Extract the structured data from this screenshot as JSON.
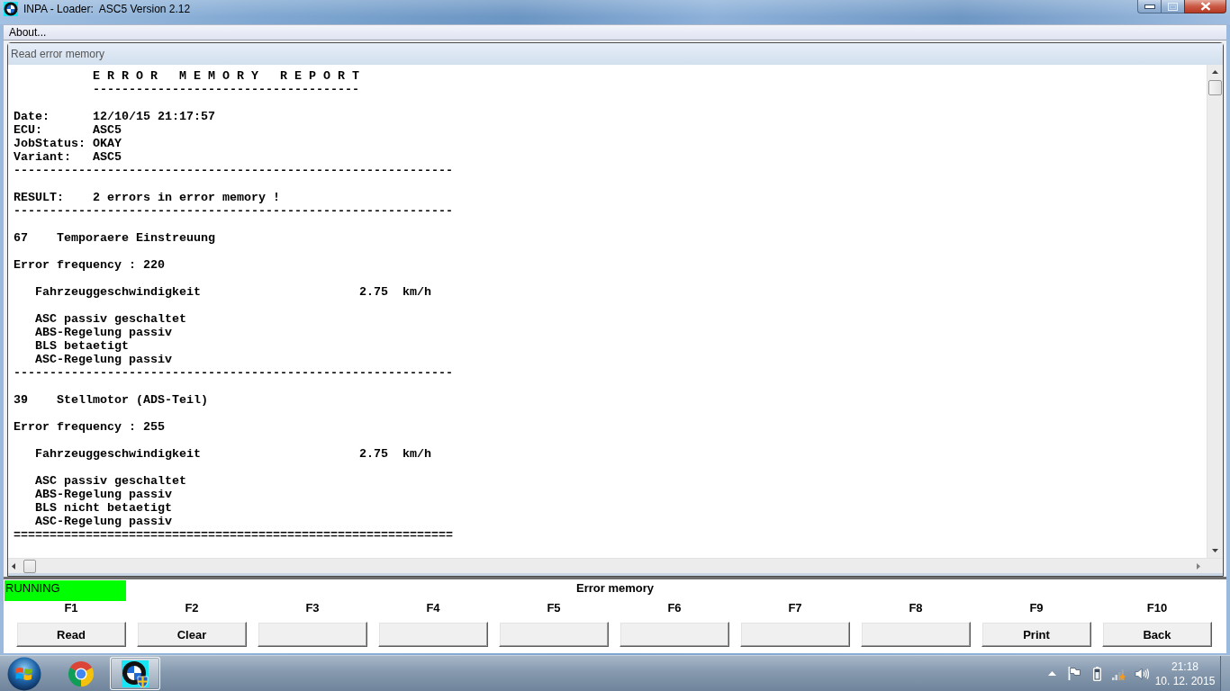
{
  "window": {
    "title": "INPA - Loader:  ASC5 Version 2.12"
  },
  "menu_bar": {
    "items": [
      "About..."
    ]
  },
  "panel": {
    "title": "Read error memory",
    "report": {
      "blocks": [
        {
          "lines": [
            {
              "kind": "title",
              "text": "E R R O R   M E M O R Y   R E P O R T"
            },
            {
              "kind": "title_rule",
              "text": "-------------------------------------"
            }
          ]
        },
        {
          "lines": [
            {
              "kind": "line",
              "text": "Date:      12/10/15 21:17:57"
            },
            {
              "kind": "line",
              "text": "ECU:       ASC5"
            },
            {
              "kind": "line",
              "text": "JobStatus: OKAY"
            },
            {
              "kind": "line",
              "text": "Variant:   ASC5"
            },
            {
              "kind": "rule",
              "text": "-------------------------------------------------------------"
            }
          ]
        },
        {
          "lines": [
            {
              "kind": "line",
              "text": "RESULT:    2 errors in error memory !"
            },
            {
              "kind": "rule",
              "text": "-------------------------------------------------------------"
            }
          ]
        },
        {
          "lines": [
            {
              "kind": "line",
              "text": "67    Temporaere Einstreuung"
            }
          ]
        },
        {
          "lines": [
            {
              "kind": "line",
              "text": "Error frequency : 220"
            }
          ]
        },
        {
          "lines": [
            {
              "kind": "detail",
              "text": "Fahrzeuggeschwindigkeit                      2.75  km/h"
            }
          ]
        },
        {
          "lines": [
            {
              "kind": "detail",
              "text": "ASC passiv geschaltet"
            },
            {
              "kind": "detail",
              "text": "ABS-Regelung passiv"
            },
            {
              "kind": "detail",
              "text": "BLS betaetigt"
            },
            {
              "kind": "detail",
              "text": "ASC-Regelung passiv"
            },
            {
              "kind": "rule",
              "text": "-------------------------------------------------------------"
            }
          ]
        },
        {
          "lines": [
            {
              "kind": "line",
              "text": "39    Stellmotor (ADS-Teil)"
            }
          ]
        },
        {
          "lines": [
            {
              "kind": "line",
              "text": "Error frequency : 255"
            }
          ]
        },
        {
          "lines": [
            {
              "kind": "detail",
              "text": "Fahrzeuggeschwindigkeit                      2.75  km/h"
            }
          ]
        },
        {
          "lines": [
            {
              "kind": "detail",
              "text": "ASC passiv geschaltet"
            },
            {
              "kind": "detail",
              "text": "ABS-Regelung passiv"
            },
            {
              "kind": "detail",
              "text": "BLS nicht betaetigt"
            },
            {
              "kind": "detail",
              "text": "ASC-Regelung passiv"
            },
            {
              "kind": "rule",
              "text": "============================================================="
            }
          ]
        }
      ]
    }
  },
  "status_bar": {
    "state": "RUNNING",
    "title": "Error memory"
  },
  "function_keys": [
    {
      "key": "F1",
      "label": "Read"
    },
    {
      "key": "F2",
      "label": "Clear"
    },
    {
      "key": "F3"
    },
    {
      "key": "F4"
    },
    {
      "key": "F5"
    },
    {
      "key": "F6"
    },
    {
      "key": "F7"
    },
    {
      "key": "F8"
    },
    {
      "key": "F9",
      "label": "Print"
    },
    {
      "key": "F10",
      "label": "Back"
    }
  ],
  "taskbar": {
    "programs": [
      {
        "kind": "browser",
        "selected": false
      },
      {
        "kind": "diagnostics",
        "selected": true
      }
    ],
    "clock": {
      "time": "21:18",
      "date": "10. 12. 2015"
    }
  }
}
